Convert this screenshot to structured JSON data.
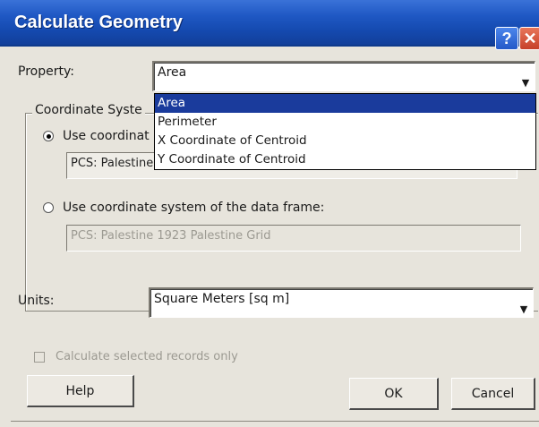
{
  "window": {
    "title": "Calculate Geometry",
    "help_glyph": "?",
    "close_glyph": "✕"
  },
  "property": {
    "label": "Property:",
    "value": "Area",
    "options": [
      "Area",
      "Perimeter",
      "X Coordinate of Centroid",
      "Y Coordinate of Centroid"
    ],
    "selected_index": 0
  },
  "coordinate_system": {
    "group_label": "Coordinate Syste",
    "option1_label": "Use coordinat",
    "option1_value": "PCS: Palestine 1923 Palestine Grid",
    "option1_selected": true,
    "option2_label": "Use coordinate system of the data frame:",
    "option2_value": "PCS: Palestine 1923 Palestine Grid",
    "option2_selected": false
  },
  "units": {
    "label": "Units:",
    "value": "Square Meters [sq m]"
  },
  "selected_only": {
    "label": "Calculate selected records only",
    "checked": false
  },
  "buttons": {
    "help": "Help",
    "ok": "OK",
    "cancel": "Cancel"
  },
  "icons": {
    "dropdown": "chevron-down-icon",
    "help": "question-mark-icon",
    "close": "close-icon"
  },
  "colors": {
    "titlebar": "#1f58c4",
    "selection": "#1a3b9c",
    "close_button": "#c6402a"
  }
}
